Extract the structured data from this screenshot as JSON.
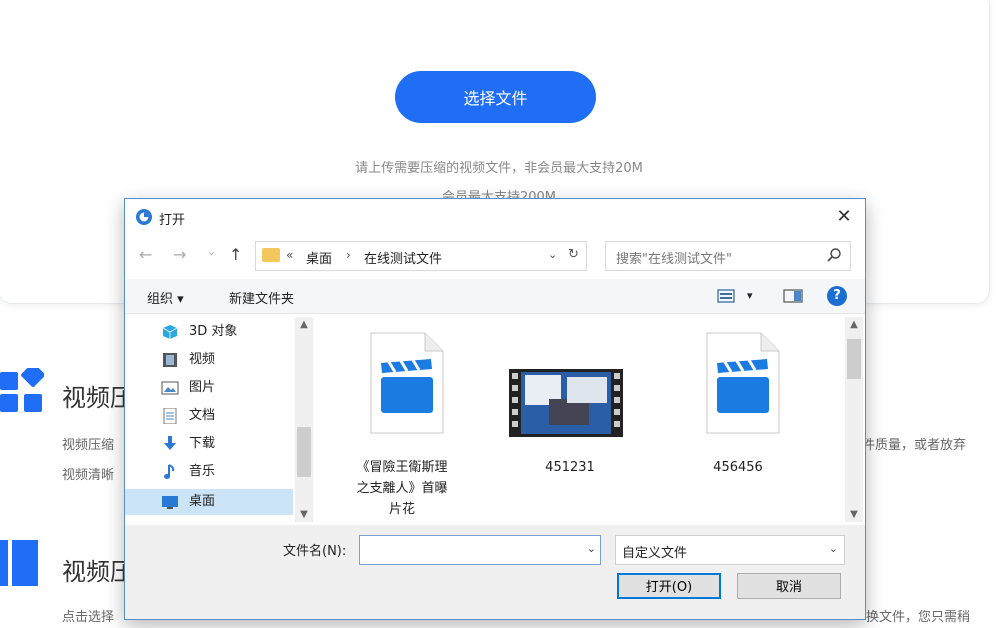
{
  "page": {
    "select_button": "选择文件",
    "hint_line1": "请上传需要压缩的视频文件，非会员最大支持20M",
    "hint_line2": "会员最大支持200M",
    "feature1_title": "视频压",
    "feature1_desc_left": "视频压缩",
    "feature1_desc_right": "件质量，或者放弃",
    "feature1_desc_left2": "视频清晰",
    "feature2_title": "视频压",
    "feature2_desc_left": "点击选择",
    "feature2_desc_right": "换文件，您只需稍"
  },
  "dialog": {
    "title": "打开",
    "close": "✕",
    "nav": {
      "back": "←",
      "forward": "→",
      "recent": "⌄",
      "up": "↑"
    },
    "address": {
      "prefix": "«",
      "seg1": "桌面",
      "sep": "›",
      "seg2": "在线测试文件",
      "dropdown": "⌄",
      "refresh": "↻"
    },
    "search_placeholder": "搜索\"在线测试文件\"",
    "toolbar": {
      "organize": "组织 ▾",
      "new_folder": "新建文件夹",
      "view_dropdown": "▾",
      "help": "?"
    },
    "sidebar": [
      {
        "label": "3D 对象",
        "icon": "cube-icon"
      },
      {
        "label": "视频",
        "icon": "film-icon"
      },
      {
        "label": "图片",
        "icon": "picture-icon"
      },
      {
        "label": "文档",
        "icon": "document-icon"
      },
      {
        "label": "下载",
        "icon": "download-icon"
      },
      {
        "label": "音乐",
        "icon": "music-icon"
      },
      {
        "label": "桌面",
        "icon": "desktop-icon"
      }
    ],
    "files": [
      {
        "name_line1": "《冒險王衛斯理",
        "name_line2": "之支離人》首曝",
        "name_line3": "片花",
        "icon": "video-file-icon"
      },
      {
        "name_line1": "451231",
        "icon": "video-thumbnail-icon"
      },
      {
        "name_line1": "456456",
        "icon": "video-file-icon"
      }
    ],
    "filename_label": "文件名(N):",
    "filename_value": "",
    "filetype": "自定义文件",
    "open_button": "打开(O)",
    "cancel_button": "取消",
    "colors": {
      "accent": "#1f6ef5",
      "selection": "#cce4f7",
      "clapper": "#1a7be3"
    }
  }
}
